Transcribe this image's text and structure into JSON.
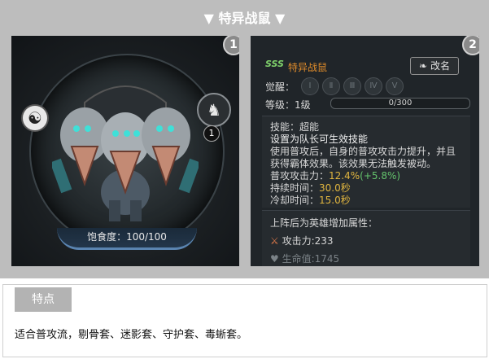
{
  "title": "▼ 特异战鼠 ▼",
  "panel_left": {
    "badge": "1",
    "level_badge": "1",
    "satiety_label": "饱食度：100/100"
  },
  "panel_right": {
    "badge": "2",
    "rank": "SSS",
    "pet_name": "特异战鼠",
    "rename_button": "改名",
    "awaken_label": "觉醒：",
    "awaken_levels": [
      "Ⅰ",
      "Ⅱ",
      "Ⅲ",
      "Ⅳ",
      "Ⅴ"
    ],
    "level_label": "等级：1级",
    "exp_text": "0/300",
    "skill_title": "技能：超能",
    "skill_sub": "设置为队长可生效技能",
    "skill_desc_1": "使用普攻后，自身的普攻攻击力提升，并且",
    "skill_desc_2": "获得霸体效果。该效果无法触发被动。",
    "attack_label": "普攻攻击力：",
    "attack_value": "12.4%",
    "attack_bonus": "(+5.8%)",
    "duration_label": "持续时间：",
    "duration_value": "30.0秒",
    "cooldown_label": "冷却时间：",
    "cooldown_value": "15.0秒",
    "attr_title": "上阵后为英雄增加属性：",
    "attr_attack": "攻击力:233",
    "attr_hp_partial": "生命值:1745"
  },
  "features": {
    "tag": "特点",
    "text": "适合普攻流，剔骨套、迷影套、守护套、毒蜥套。"
  },
  "colors": {
    "frame": "#bdbdbd",
    "orange": "#e08c2a",
    "green": "#64c36c",
    "yellow": "#e0b53f"
  }
}
